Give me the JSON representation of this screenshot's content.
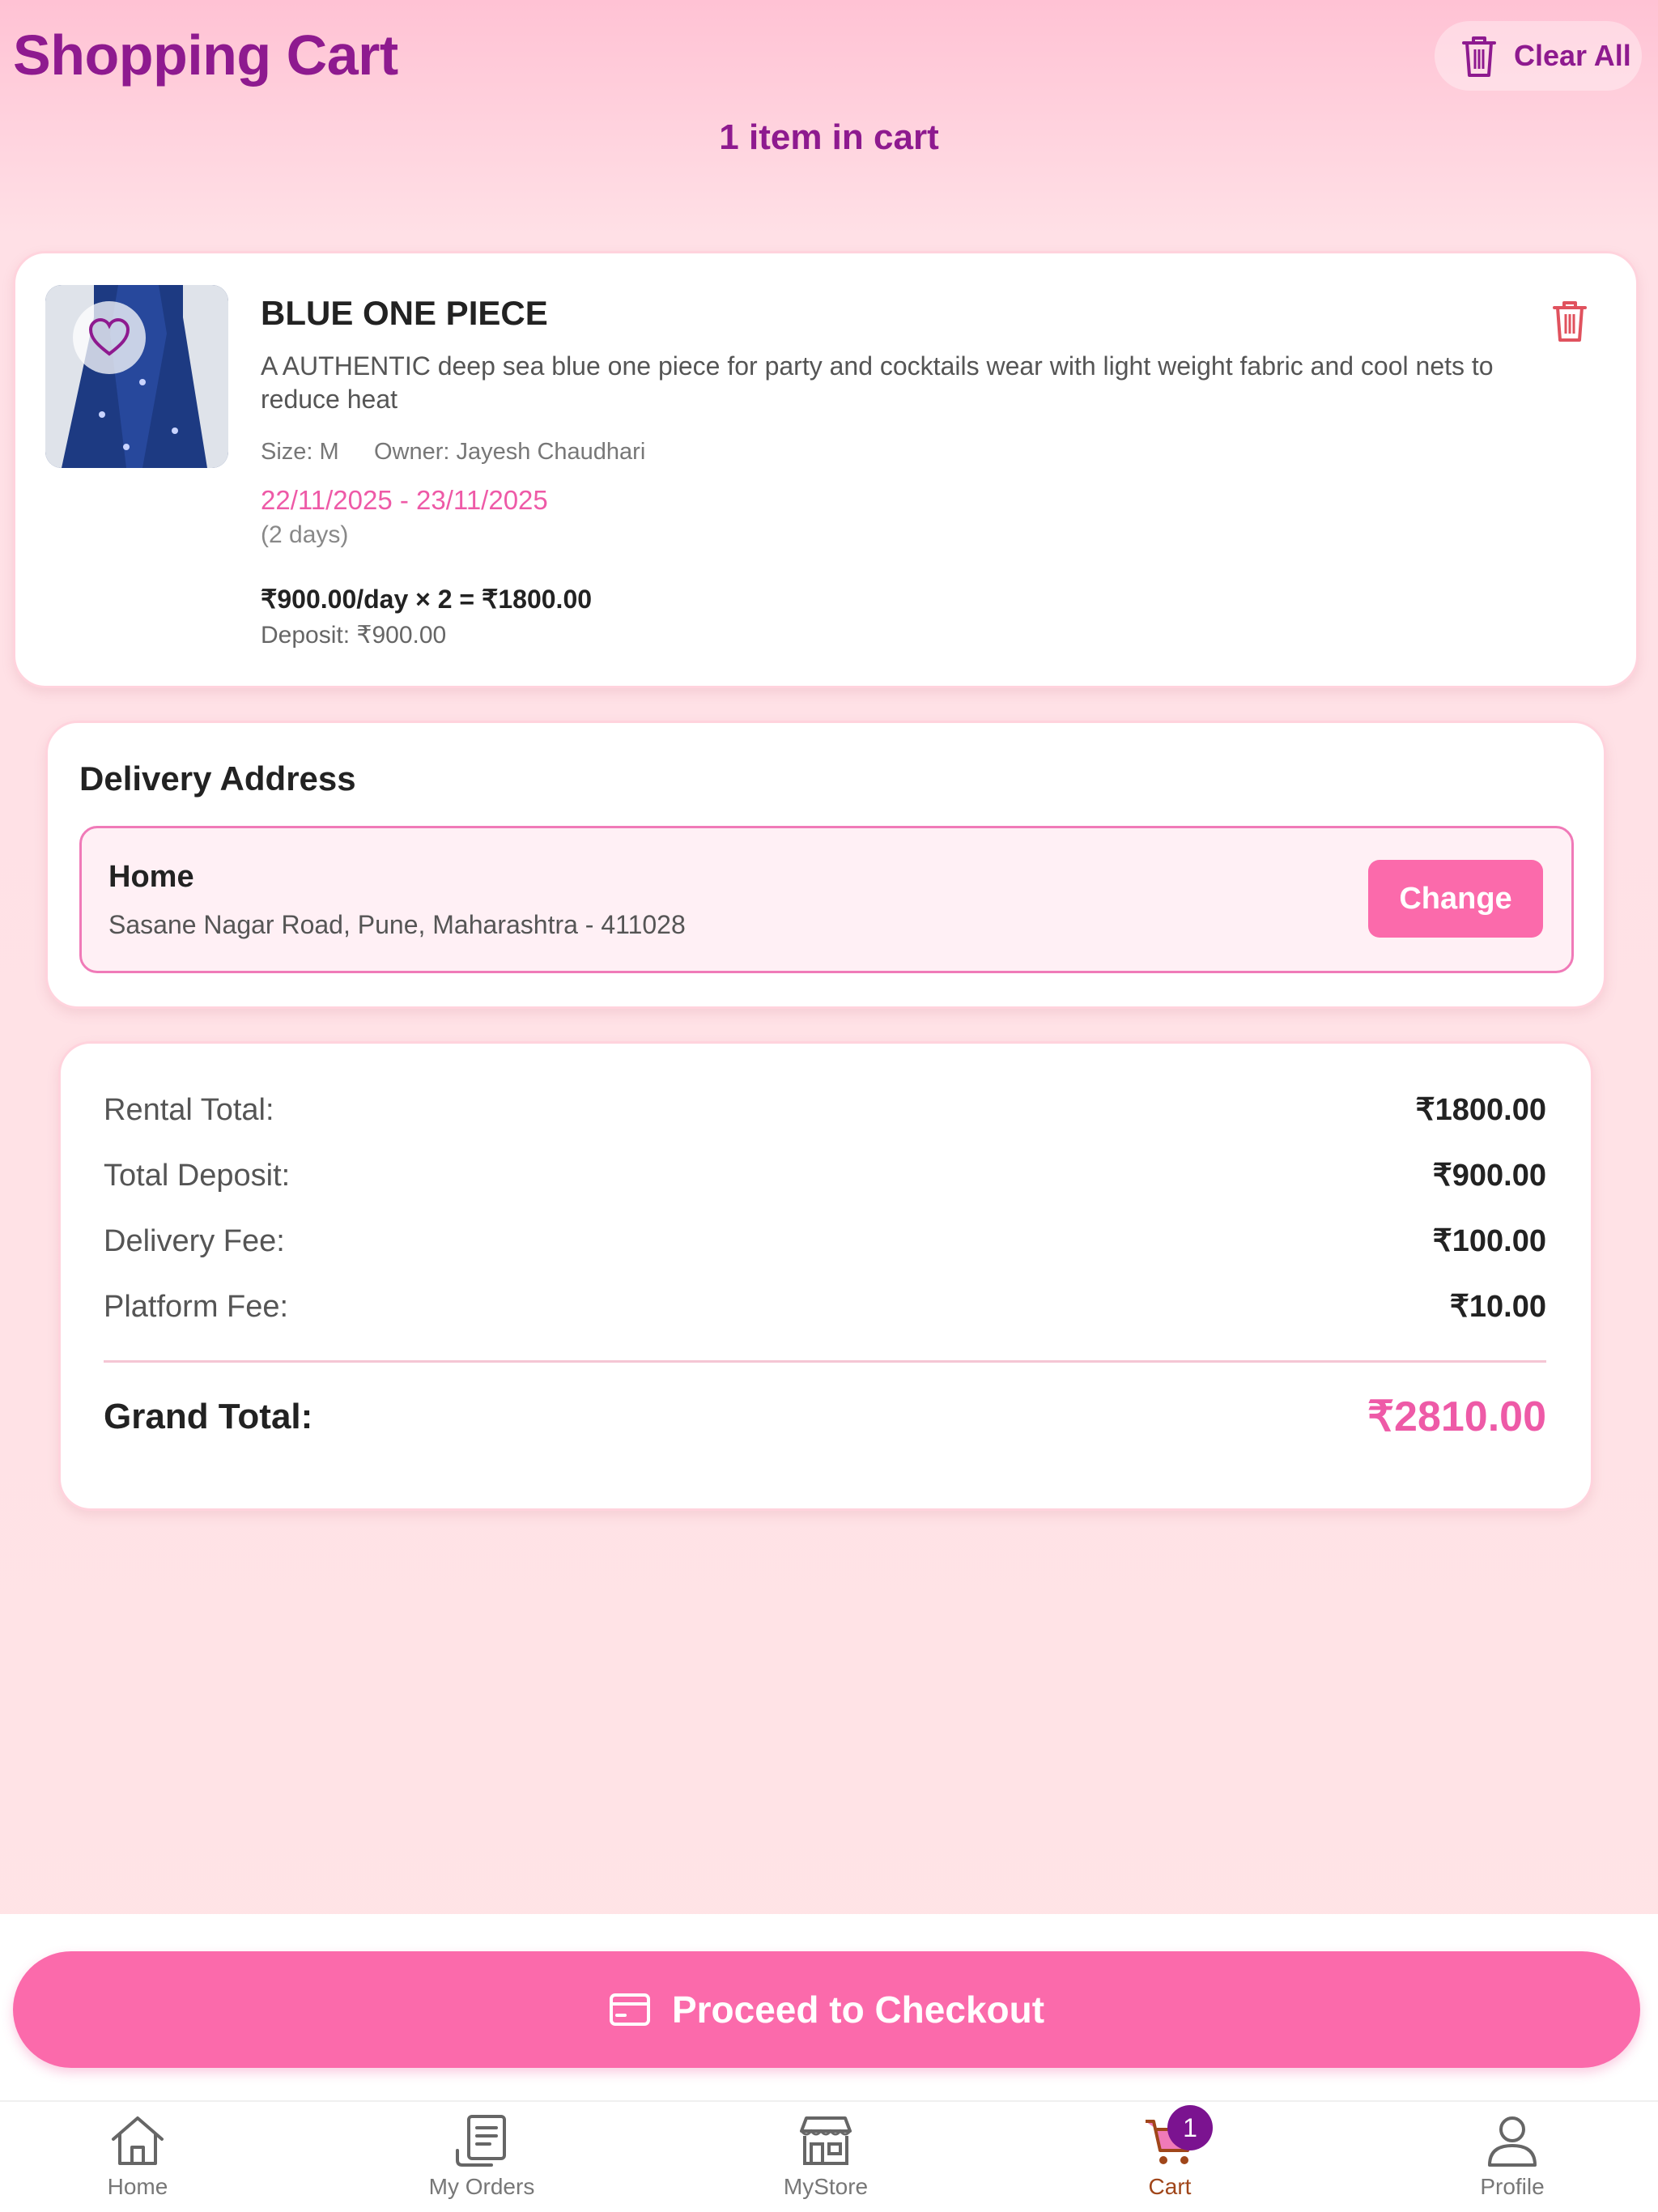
{
  "header": {
    "title": "Shopping Cart",
    "clear_all_label": "Clear All",
    "item_count": "1 item in cart"
  },
  "cart_item": {
    "name": "BLUE ONE PIECE",
    "description": "A AUTHENTIC deep sea blue one piece for party and cocktails wear with light weight fabric and cool nets to reduce heat",
    "size": "Size: M",
    "owner": "Owner: Jayesh Chaudhari",
    "dates": "22/11/2025 - 23/11/2025",
    "duration": "(2 days)",
    "price_calc": "₹900.00/day × 2 = ₹1800.00",
    "deposit": "Deposit: ₹900.00"
  },
  "delivery": {
    "section_title": "Delivery Address",
    "address_label": "Home",
    "address_line": "Sasane Nagar Road, Pune, Maharashtra - 411028",
    "change_label": "Change"
  },
  "summary": {
    "rows": [
      {
        "label": "Rental Total:",
        "value": "₹1800.00"
      },
      {
        "label": "Total Deposit:",
        "value": "₹900.00"
      },
      {
        "label": "Delivery Fee:",
        "value": "₹100.00"
      },
      {
        "label": "Platform Fee:",
        "value": "₹10.00"
      }
    ],
    "grand_total_label": "Grand Total:",
    "grand_total_value": "₹2810.00"
  },
  "checkout": {
    "label": "Proceed to Checkout"
  },
  "bottom_nav": {
    "items": [
      {
        "label": "Home",
        "icon": "home-icon"
      },
      {
        "label": "My Orders",
        "icon": "orders-icon"
      },
      {
        "label": "MyStore",
        "icon": "store-icon"
      },
      {
        "label": "Cart",
        "icon": "cart-icon",
        "active": true
      },
      {
        "label": "Profile",
        "icon": "profile-icon"
      }
    ],
    "cart_badge": "1"
  },
  "colors": {
    "accent_purple": "#8e1a8f",
    "accent_pink": "#fb6aab",
    "price_pink": "#ee5aa7",
    "delete_red": "#e0525e"
  }
}
